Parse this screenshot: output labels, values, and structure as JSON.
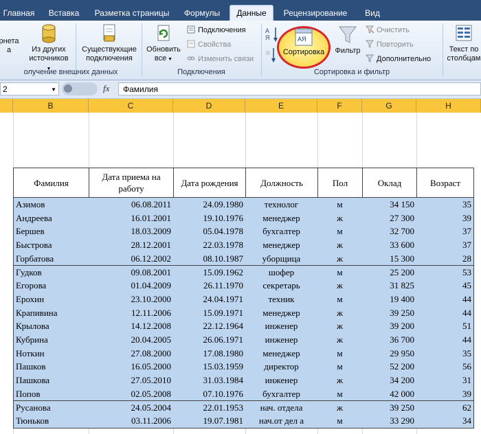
{
  "tabs": [
    {
      "label": "Главная",
      "active": false
    },
    {
      "label": "Вставка",
      "active": false
    },
    {
      "label": "Разметка страницы",
      "active": false
    },
    {
      "label": "Формулы",
      "active": false
    },
    {
      "label": "Данные",
      "active": true
    },
    {
      "label": "Рецензирование",
      "active": false
    },
    {
      "label": "Вид",
      "active": false
    }
  ],
  "ribbon": {
    "partial_btn_label_1": "рнета",
    "partial_btn_label_2": "а",
    "other_sources_label_1": "Из других",
    "other_sources_label_2": "источников",
    "existing_conn_label_1": "Существующие",
    "existing_conn_label_2": "подключения",
    "group_external": "олучение внешних данных",
    "refresh_label_1": "Обновить",
    "refresh_label_2": "все",
    "connections": "Подключения",
    "properties": "Свойства",
    "edit_links": "Изменить связи",
    "group_connections": "Подключения",
    "sort_label": "Сортировка",
    "filter_label": "Фильтр",
    "clear": "Очистить",
    "reapply": "Повторить",
    "advanced": "Дополнительно",
    "group_sort_filter": "Сортировка и фильтр",
    "text_to_cols_1": "Текст по",
    "text_to_cols_2": "столбцам",
    "sort_az_top": "А",
    "sort_az_bottom": "Я",
    "sort_dialog_letters": "АЯ"
  },
  "formula_bar": {
    "name_box": "2",
    "fx": "fx",
    "formula": "Фамилия"
  },
  "columns": [
    "B",
    "C",
    "D",
    "E",
    "F",
    "G",
    "H"
  ],
  "table": {
    "headers": [
      "Фамилия",
      "Дата приема на работу",
      "Дата рождения",
      "Должность",
      "Пол",
      "Оклад",
      "Возраст"
    ],
    "rows": [
      [
        "Азимов",
        "06.08.2011",
        "24.09.1980",
        "технолог",
        "м",
        "34 150",
        "35"
      ],
      [
        "Андреева",
        "16.01.2001",
        "19.10.1976",
        "менеджер",
        "ж",
        "27 300",
        "39"
      ],
      [
        "Бершев",
        "18.03.2009",
        "05.04.1978",
        "бухгалтер",
        "м",
        "32 700",
        "37"
      ],
      [
        "Быстрова",
        "28.12.2001",
        "22.03.1978",
        "менеджер",
        "ж",
        "33 600",
        "37"
      ],
      [
        "Горбатова",
        "06.12.2002",
        "08.10.1987",
        "уборщица",
        "ж",
        "15 300",
        "28"
      ],
      [
        "Гудков",
        "09.08.2001",
        "15.09.1962",
        "шофер",
        "м",
        "25 200",
        "53"
      ],
      [
        "Егорова",
        "01.04.2009",
        "26.11.1970",
        "секретарь",
        "ж",
        "31 825",
        "45"
      ],
      [
        "Ерохин",
        "23.10.2000",
        "24.04.1971",
        "техник",
        "м",
        "19 400",
        "44"
      ],
      [
        "Крапивина",
        "12.11.2006",
        "15.09.1971",
        "менеджер",
        "ж",
        "39 250",
        "44"
      ],
      [
        "Крылова",
        "14.12.2008",
        "22.12.1964",
        "инженер",
        "ж",
        "39 200",
        "51"
      ],
      [
        "Кубрина",
        "20.04.2005",
        "26.06.1971",
        "инженер",
        "ж",
        "36 700",
        "44"
      ],
      [
        "Ноткин",
        "27.08.2000",
        "17.08.1980",
        "менеджер",
        "м",
        "29 950",
        "35"
      ],
      [
        "Пашков",
        "16.05.2000",
        "15.03.1959",
        "директор",
        "м",
        "52 200",
        "56"
      ],
      [
        "Пашкова",
        "27.05.2010",
        "31.03.1984",
        "инженер",
        "ж",
        "34 200",
        "31"
      ],
      [
        "Попов",
        "02.05.2008",
        "07.10.1976",
        "бухгалтер",
        "м",
        "42 000",
        "39"
      ],
      [
        "Русанова",
        "24.05.2004",
        "22.01.1953",
        "нач. отдела",
        "ж",
        "39 250",
        "62"
      ],
      [
        "Тюньков",
        "03.11.2006",
        "19.07.1981",
        "нач.от дел а",
        "м",
        "33 290",
        "34"
      ]
    ]
  },
  "colors": {
    "tab_bar": "#2c4f7c",
    "column_header_highlight": "#f8c53b",
    "selection_fill": "#bed5ef",
    "highlight_circle": "#d9262b"
  }
}
